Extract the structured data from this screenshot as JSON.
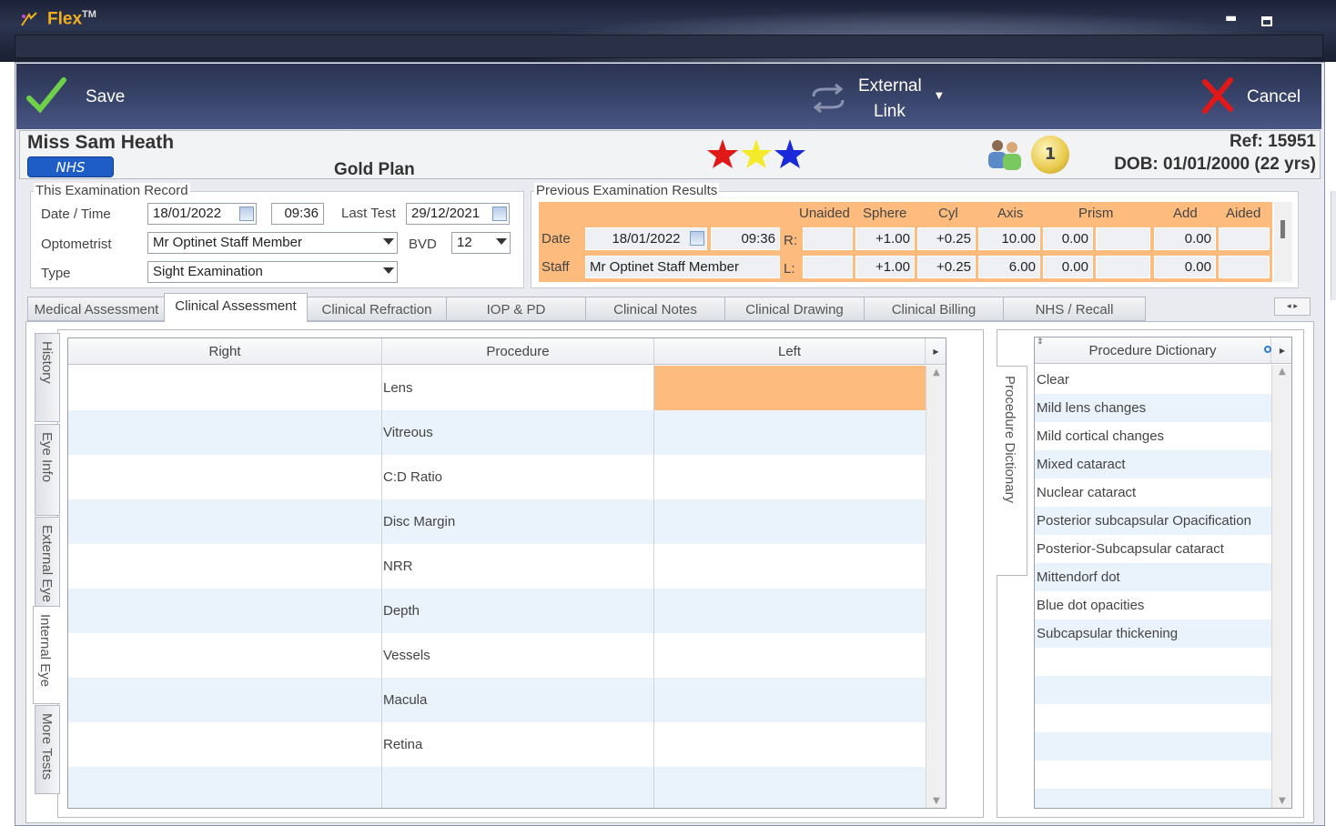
{
  "app": {
    "name": "Flex",
    "tm": "TM"
  },
  "toolbar": {
    "save_label": "Save",
    "external_label_1": "External",
    "external_label_2": "Link",
    "cancel_label": "Cancel"
  },
  "patient": {
    "name": "Miss Sam Heath",
    "badge": "NHS",
    "plan": "Gold Plan",
    "ref": "Ref: 15951",
    "dob": "DOB: 01/01/2000 (22 yrs)",
    "coin": "1"
  },
  "exam": {
    "title": "This Examination Record",
    "date_label": "Date / Time",
    "date": "18/01/2022",
    "time": "09:36",
    "last_test_label": "Last Test",
    "last_test": "29/12/2021",
    "optometrist_label": "Optometrist",
    "optometrist": "Mr Optinet Staff Member",
    "bvd_label": "BVD",
    "bvd": "12",
    "type_label": "Type",
    "type": "Sight Examination"
  },
  "previous": {
    "title": "Previous Examination Results",
    "headers": [
      "Unaided",
      "Sphere",
      "Cyl",
      "Axis",
      "Prism",
      "Add",
      "Aided"
    ],
    "date_label": "Date",
    "date": "18/01/2022",
    "time": "09:36",
    "staff_label": "Staff",
    "staff": "Mr Optinet Staff Member",
    "r_label": "R:",
    "l_label": "L:",
    "right": {
      "unaided": "",
      "sphere": "+1.00",
      "cyl": "+0.25",
      "axis": "10.00",
      "prism": "0.00",
      "prism2": "",
      "add": "0.00",
      "aided": ""
    },
    "left": {
      "unaided": "",
      "sphere": "+1.00",
      "cyl": "+0.25",
      "axis": "6.00",
      "prism": "0.00",
      "prism2": "",
      "add": "0.00",
      "aided": ""
    }
  },
  "tabs": [
    "Medical Assessment",
    "Clinical Assessment",
    "Clinical Refraction",
    "IOP & PD",
    "Clinical Notes",
    "Clinical Drawing",
    "Clinical Billing",
    "NHS / Recall"
  ],
  "vtabs": [
    "History",
    "Eye Info",
    "External Eye",
    "Internal Eye",
    "More Tests"
  ],
  "grid": {
    "headers": [
      "Right",
      "Procedure",
      "Left"
    ],
    "rows": [
      "Lens",
      "Vitreous",
      "C:D Ratio",
      "Disc Margin",
      "NRR",
      "Depth",
      "Vessels",
      "Macula",
      "Retina",
      ""
    ]
  },
  "dictionary": {
    "side_label": "Procedure Dictionary",
    "header": "Procedure Dictionary",
    "items": [
      "Clear",
      "Mild lens changes",
      "Mild cortical changes",
      "Mixed cataract",
      "Nuclear cataract",
      "Posterior subcapsular Opacification",
      "Posterior-Subcapsular cataract",
      "Mittendorf dot",
      "Blue dot opacities",
      "Subcapsular thickening",
      "",
      "",
      "",
      "",
      "",
      ""
    ]
  },
  "colors": {
    "highlight": "#fdbc7d",
    "alt_row": "#eaf2fb",
    "nhs": "#1d5dc5"
  }
}
